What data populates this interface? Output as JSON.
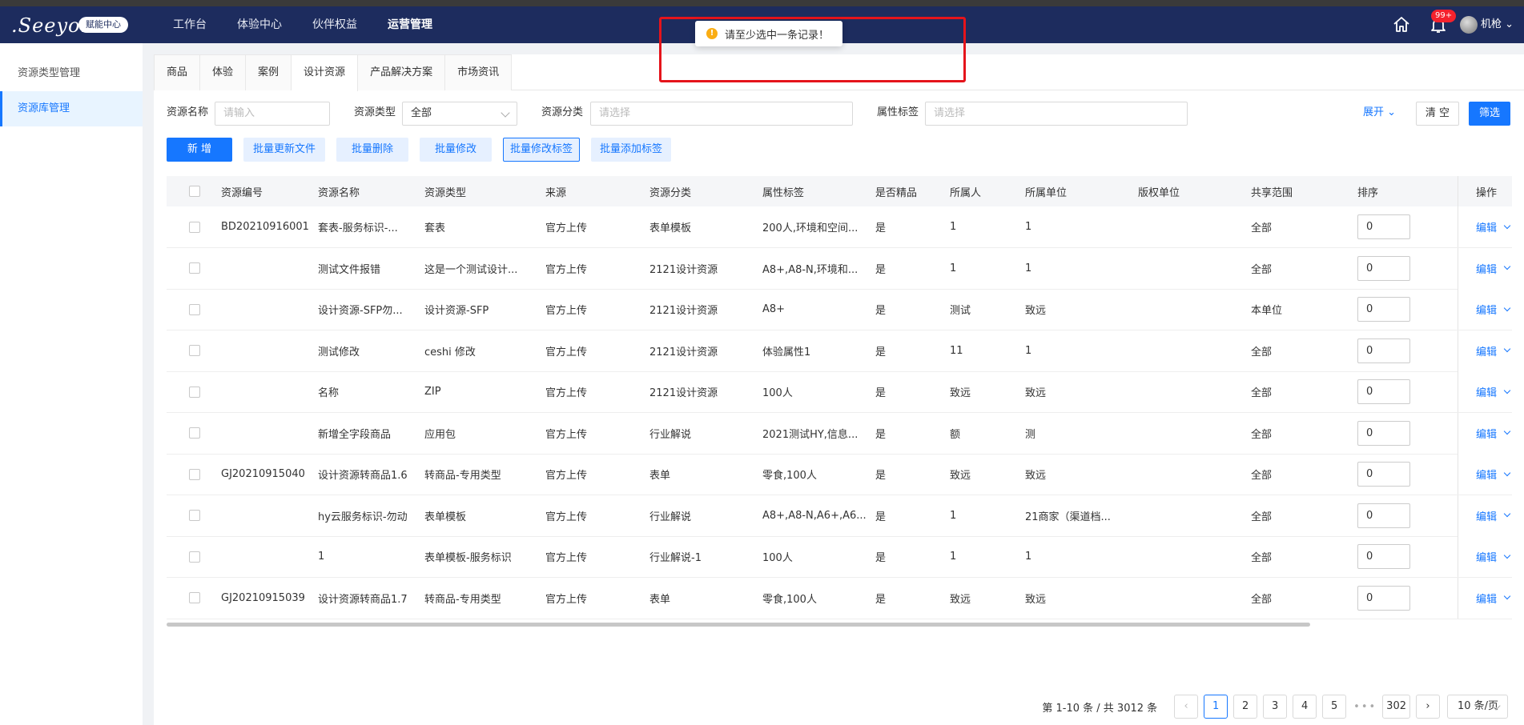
{
  "header": {
    "logo": ".Seeyon",
    "logo_badge": "赋能中心",
    "nav": [
      "工作台",
      "体验中心",
      "伙伴权益",
      "运营管理"
    ],
    "active_nav": "运营管理",
    "bell_badge": "99+",
    "user_name": "机枪"
  },
  "sidebar": {
    "items": [
      "资源类型管理",
      "资源库管理"
    ],
    "active": "资源库管理"
  },
  "tabs": [
    "商品",
    "体验",
    "案例",
    "设计资源",
    "产品解决方案",
    "市场资讯"
  ],
  "active_tab": "设计资源",
  "filters": {
    "name_label": "资源名称",
    "name_placeholder": "请输入",
    "type_label": "资源类型",
    "type_value": "全部",
    "category_label": "资源分类",
    "category_placeholder": "请选择",
    "tag_label": "属性标签",
    "tag_placeholder": "请选择",
    "expand": "展开",
    "clear": "清 空",
    "filter": "筛选"
  },
  "actions": [
    "新 增",
    "批量更新文件",
    "批量删除",
    "批量修改",
    "批量修改标签",
    "批量添加标签"
  ],
  "table": {
    "columns": [
      "资源编号",
      "资源名称",
      "资源类型",
      "来源",
      "资源分类",
      "属性标签",
      "是否精品",
      "所属人",
      "所属单位",
      "版权单位",
      "共享范围",
      "排序",
      "操作"
    ],
    "rows": [
      [
        "BD20210916001",
        "套表-服务标识-...",
        "套表",
        "官方上传",
        "表单模板",
        "200人,环境和空间...",
        "是",
        "1",
        "1",
        "",
        "全部",
        "0"
      ],
      [
        "",
        "测试文件报错",
        "这是一个测试设计...",
        "官方上传",
        "2121设计资源",
        "A8+,A8-N,环境和...",
        "是",
        "1",
        "1",
        "",
        "全部",
        "0"
      ],
      [
        "",
        "设计资源-SFP勿...",
        "设计资源-SFP",
        "官方上传",
        "2121设计资源",
        "A8+",
        "是",
        "测试",
        "致远",
        "",
        "本单位",
        "0"
      ],
      [
        "",
        "测试修改",
        "ceshi 修改",
        "官方上传",
        "2121设计资源",
        "体验属性1",
        "是",
        "11",
        "1",
        "",
        "全部",
        "0"
      ],
      [
        "",
        "名称",
        "ZIP",
        "官方上传",
        "2121设计资源",
        "100人",
        "是",
        "致远",
        "致远",
        "",
        "全部",
        "0"
      ],
      [
        "",
        "新增全字段商品",
        "应用包",
        "官方上传",
        "行业解说",
        "2021测试HY,信息...",
        "是",
        "额",
        "测",
        "",
        "全部",
        "0"
      ],
      [
        "GJ20210915040",
        "设计资源转商品1.6",
        "转商品-专用类型",
        "官方上传",
        "表单",
        "零食,100人",
        "是",
        "致远",
        "致远",
        "",
        "全部",
        "0"
      ],
      [
        "",
        "hy云服务标识-勿动",
        "表单模板",
        "官方上传",
        "行业解说",
        "A8+,A8-N,A6+,A6...",
        "是",
        "1",
        "21商家（渠道档...",
        "",
        "全部",
        "0"
      ],
      [
        "",
        "1",
        "表单模板-服务标识",
        "官方上传",
        "行业解说-1",
        "100人",
        "是",
        "1",
        "1",
        "",
        "全部",
        "0"
      ],
      [
        "GJ20210915039",
        "设计资源转商品1.7",
        "转商品-专用类型",
        "官方上传",
        "表单",
        "零食,100人",
        "是",
        "致远",
        "致远",
        "",
        "全部",
        "0"
      ]
    ],
    "op_label": "编辑"
  },
  "pagination": {
    "info": "第 1-10 条 / 共 3012 条",
    "pages": [
      "1",
      "2",
      "3",
      "4",
      "5"
    ],
    "current": "1",
    "last": "302",
    "page_size": "10 条/页"
  },
  "toast": {
    "message": "请至少选中一条记录！",
    "icon": "warning-icon"
  },
  "colors": {
    "header_bg": "#1d2c5e",
    "primary": "#1677ff",
    "highlight_box": "#e5141b",
    "toast_icon": "#faad14"
  }
}
